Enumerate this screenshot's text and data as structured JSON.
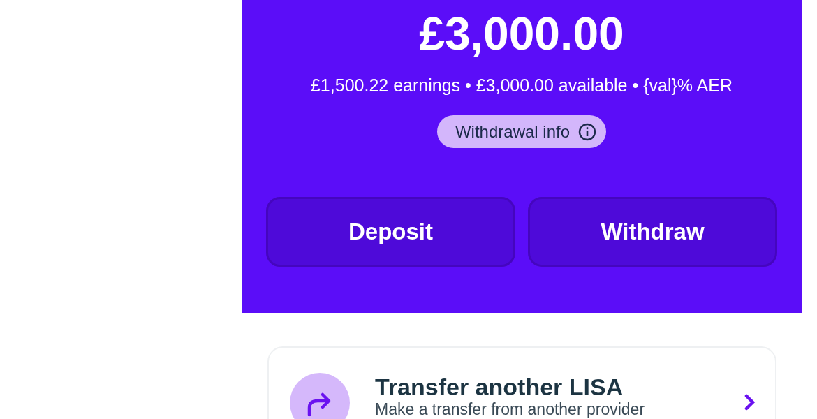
{
  "balance": {
    "amount": "£3,000.00",
    "summary": "£1,500.22 earnings • £3,000.00 available • {val}% AER",
    "info_chip": "Withdrawal info"
  },
  "actions": [
    "Deposit",
    "Withdraw"
  ],
  "transfer_card": {
    "title": "Transfer another LISA",
    "subtitle": "Make a transfer from another provider"
  }
}
